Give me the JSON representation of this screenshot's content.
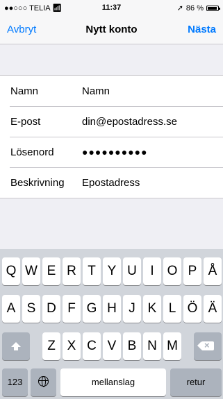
{
  "status_bar": {
    "carrier": "●●○○○ TELIA",
    "time": "11:37",
    "battery": "86 %"
  },
  "nav": {
    "cancel": "Avbryt",
    "title": "Nytt konto",
    "next": "Nästa"
  },
  "form": {
    "rows": [
      {
        "label": "Namn",
        "value": "Namn"
      },
      {
        "label": "E-post",
        "value": "din@epostadress.se"
      },
      {
        "label": "Lösenord",
        "value": "●●●●●●●●●●"
      },
      {
        "label": "Beskrivning",
        "value": "Epostadress"
      }
    ]
  },
  "keyboard": {
    "row1": [
      "Q",
      "W",
      "E",
      "R",
      "T",
      "Y",
      "U",
      "I",
      "O",
      "P",
      "Å"
    ],
    "row2": [
      "A",
      "S",
      "D",
      "F",
      "G",
      "H",
      "J",
      "K",
      "L",
      "Ö",
      "Ä"
    ],
    "row3": [
      "Z",
      "X",
      "C",
      "V",
      "B",
      "N",
      "M"
    ],
    "numbers": "123",
    "space": "mellanslag",
    "return": "retur"
  },
  "colors": {
    "accent": "#007aff",
    "keyboard_bg": "#d1d5db"
  }
}
